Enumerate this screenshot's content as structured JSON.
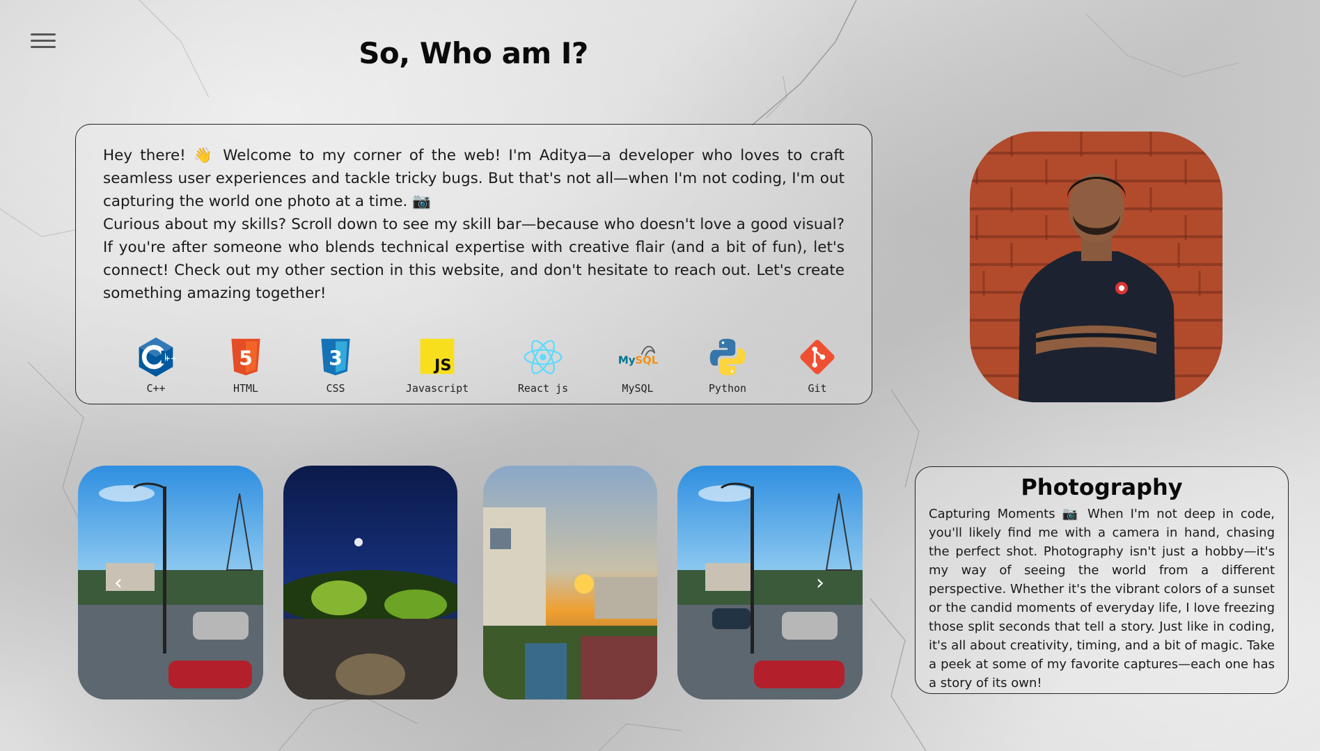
{
  "page": {
    "title": "So, Who am I?"
  },
  "menu": {
    "icon": "hamburger-menu-icon"
  },
  "about": {
    "paragraph1": "Hey there! 👋 Welcome to my corner of the web! I'm Aditya—a developer who loves to craft seamless user experiences and tackle tricky bugs. But that's not all—when I'm not coding, I'm out capturing the world one photo at a time. 📷",
    "paragraph2": "Curious about my skills? Scroll down to see my skill bar—because who doesn't love a good visual? If you're after someone who blends technical expertise with creative flair (and a bit of fun), let's connect! Check out my other section in this website, and don't hesitate to reach out. Let's create something amazing together!"
  },
  "skills": [
    {
      "label": "C++",
      "icon": "cpp-logo-icon",
      "color": "#00599C"
    },
    {
      "label": "HTML",
      "icon": "html5-logo-icon",
      "color": "#E44D26"
    },
    {
      "label": "CSS",
      "icon": "css3-logo-icon",
      "color": "#1572B6"
    },
    {
      "label": "Javascript",
      "icon": "javascript-logo-icon",
      "color": "#F7DF1E"
    },
    {
      "label": "React js",
      "icon": "react-logo-icon",
      "color": "#61DAFB"
    },
    {
      "label": "MySQL",
      "icon": "mysql-logo-icon",
      "color": "#00758F"
    },
    {
      "label": "Python",
      "icon": "python-logo-icon",
      "color": "#3776AB"
    },
    {
      "label": "Git",
      "icon": "git-logo-icon",
      "color": "#F05032"
    }
  ],
  "profile": {
    "alt": "profile-photo"
  },
  "carousel": {
    "prev_icon": "chevron-left-icon",
    "next_icon": "chevron-right-icon",
    "prev_glyph": "‹",
    "next_glyph": "›",
    "slides": [
      "rainy-street-photo",
      "night-park-photo",
      "sunset-rooftop-photo",
      "rainy-street-photo"
    ]
  },
  "photography": {
    "heading": "Photography",
    "text": "Capturing Moments 📷 When I'm not deep in code, you'll likely find me with a camera in hand, chasing the perfect shot. Photography isn't just a hobby—it's my way of seeing the world from a different perspective. Whether it's the vibrant colors of a sunset or the candid moments of everyday life, I love freezing those split seconds that tell a story. Just like in coding, it's all about creativity, timing, and a bit of magic. Take a peek at some of my favorite captures—each one has a story of its own!"
  }
}
